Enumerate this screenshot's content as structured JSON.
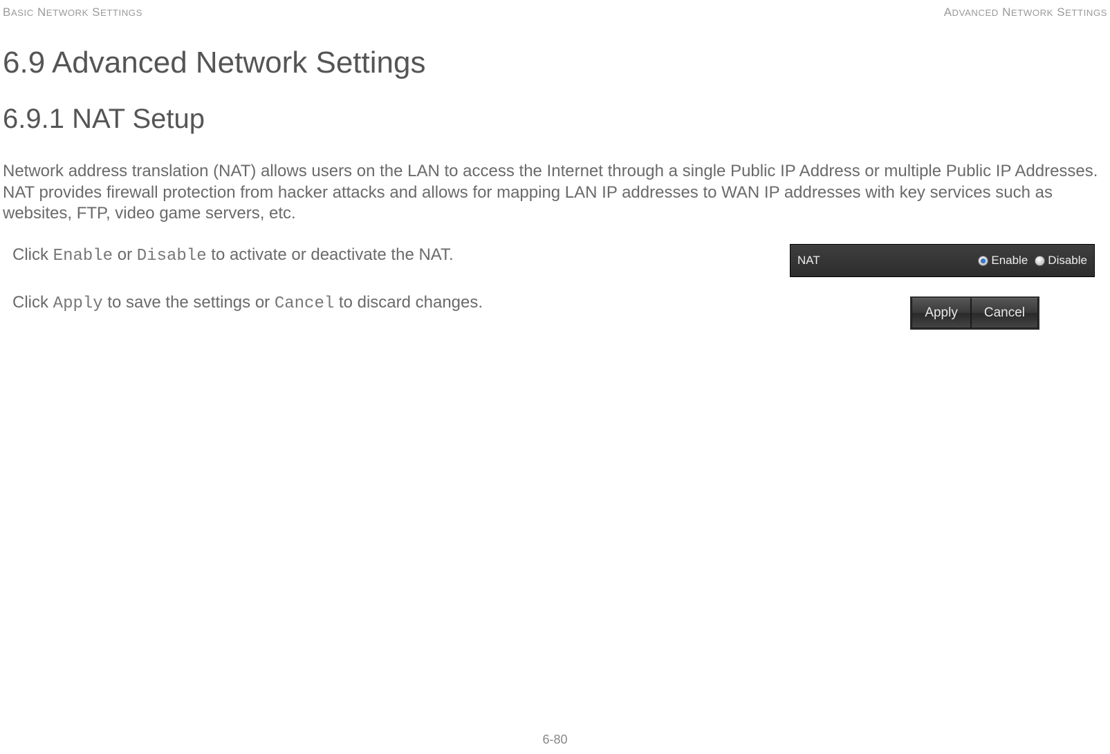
{
  "header": {
    "left": "Basic Network Settings",
    "right": "Advanced Network Settings"
  },
  "section": {
    "title": "6.9 Advanced Network Settings",
    "subtitle": "6.9.1 NAT Setup",
    "intro": "Network address translation (NAT) allows users on the LAN to access the Internet through a single Public IP Address or multiple Public IP Addresses. NAT provides firewall protection from hacker attacks and allows for mapping LAN IP addresses to WAN IP addresses with key services such as websites, FTP, video game servers, etc."
  },
  "instructions": {
    "line1_pre": "Click ",
    "enable": "Enable",
    "line1_mid": " or ",
    "disable": "Disable",
    "line1_post": " to activate or deactivate the NAT.",
    "line2_pre": "Click ",
    "apply": "Apply",
    "line2_mid": " to save the settings or ",
    "cancel": "Cancel",
    "line2_post": " to discard changes."
  },
  "nat_panel": {
    "label": "NAT",
    "option_enable": "Enable",
    "option_disable": "Disable",
    "selected": "Enable"
  },
  "buttons": {
    "apply": "Apply",
    "cancel": "Cancel"
  },
  "footer": {
    "page": "6-80"
  }
}
